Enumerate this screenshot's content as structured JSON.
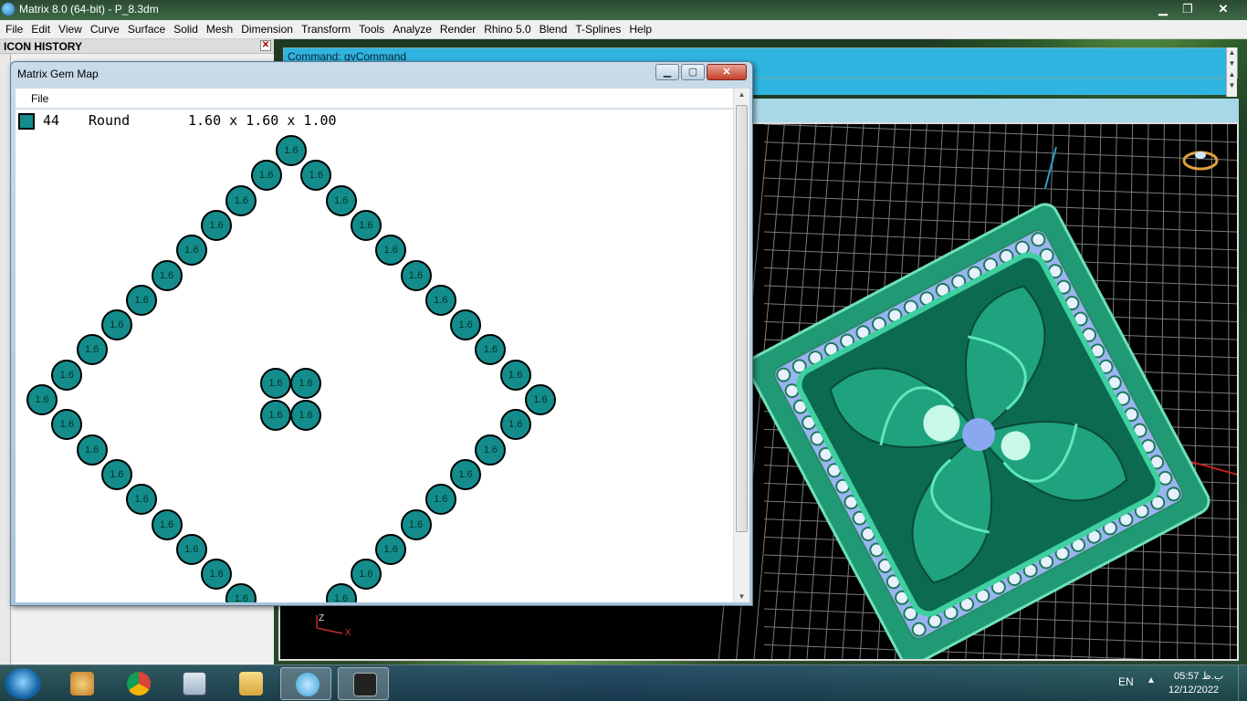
{
  "app": {
    "title": "Matrix 8.0 (64-bit) - P_8.3dm",
    "controls": {
      "minimize": "▁",
      "maximize": "❐",
      "close": "✕"
    }
  },
  "menubar": [
    "File",
    "Edit",
    "View",
    "Curve",
    "Surface",
    "Solid",
    "Mesh",
    "Dimension",
    "Transform",
    "Tools",
    "Analyze",
    "Render",
    "Rhino 5.0",
    "Blend",
    "T-Splines",
    "Help"
  ],
  "icon_history": {
    "title": "ICON HISTORY",
    "close": "✕"
  },
  "command": {
    "line1": "Command:  gvCommand"
  },
  "gem_map": {
    "title": "Matrix Gem Map",
    "menu_file": "File",
    "summary": {
      "count": "44",
      "shape": "Round",
      "dims": "1.60 x 1.60 x 1.00"
    },
    "gem_label": "1.6",
    "gem_color": "#148c8c"
  },
  "viewport": {
    "axis_z": "Z",
    "axis_x": "X"
  },
  "taskbar": {
    "language": "EN",
    "time": "05:57 ب.ظ",
    "date": "12/12/2022",
    "apps": [
      "paint",
      "chrome",
      "calculator",
      "explorer",
      "v8",
      "rhino"
    ]
  }
}
